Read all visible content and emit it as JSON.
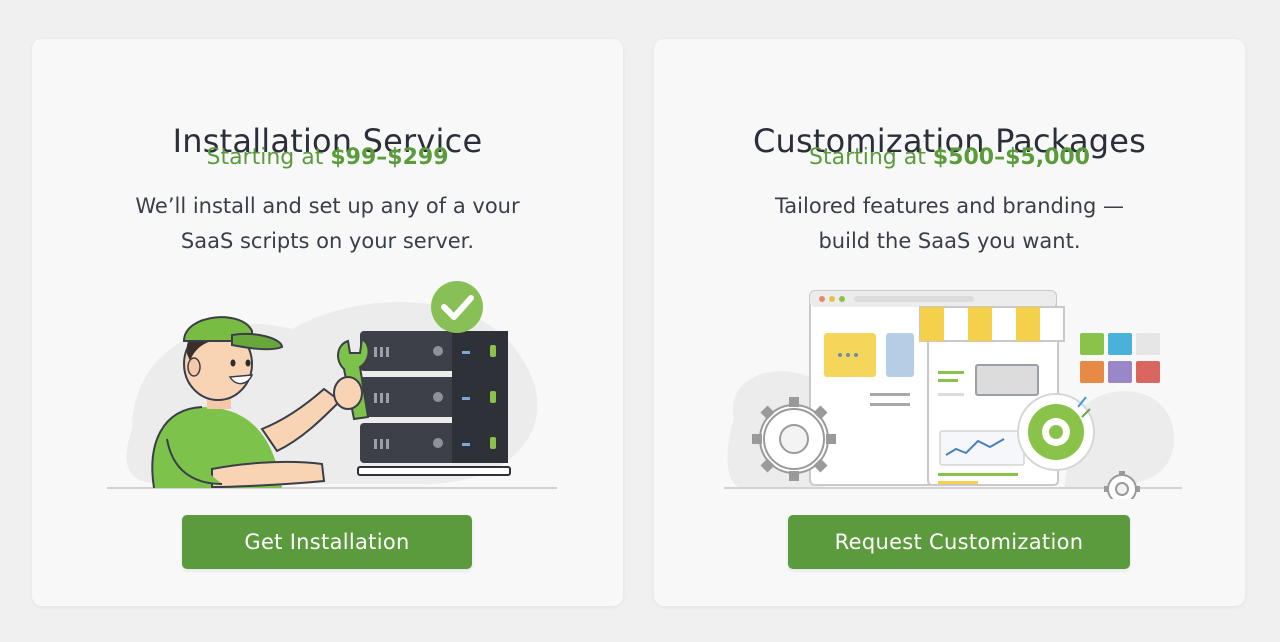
{
  "cards": [
    {
      "title": "Installation Service",
      "price_prefix": "Starting at ",
      "price_value": "$99–$299",
      "desc_line1": "We’ll install and set up any of a vour",
      "desc_line2": "SaaS scripts on your server.",
      "button_label": "Get Installation"
    },
    {
      "title": "Customization Packages",
      "price_prefix": "Starting at ",
      "price_value": "$500–$5,000",
      "desc_line1": "Tailored features and branding —",
      "desc_line2": "build the SaaS you want.",
      "button_label": "Request Customization"
    }
  ],
  "colors": {
    "accent_green": "#5c9b3d",
    "price_green": "#5a9b3b",
    "card_bg": "#f8f8f8",
    "page_bg": "#f0f0f0",
    "title_text": "#2b2f3a"
  },
  "icons": {
    "left_illustration": "technician-with-server-illustration",
    "right_illustration": "customization-storefront-illustration"
  }
}
